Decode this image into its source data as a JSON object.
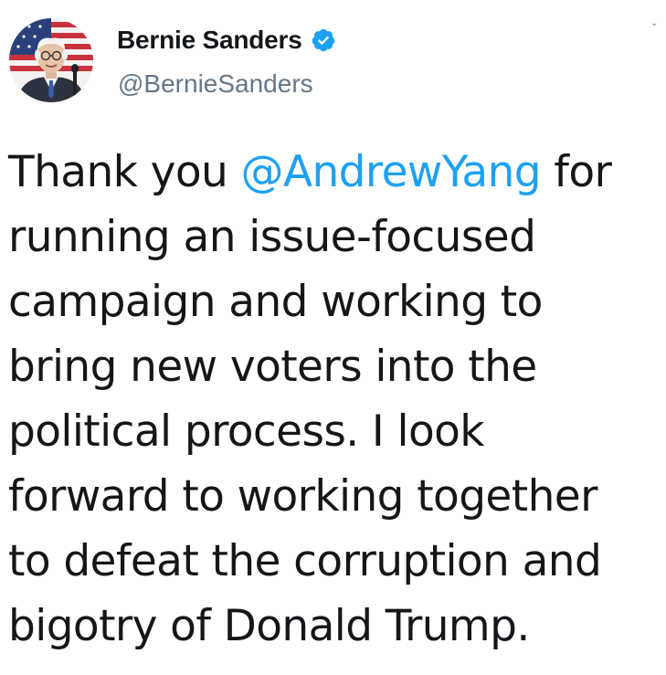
{
  "author": {
    "display_name": "Bernie Sanders",
    "handle": "@BernieSanders",
    "verified": true
  },
  "tweet": {
    "line1_before": "Thank you ",
    "mention": "@AndrewYang",
    "line1_after": " for",
    "lines": [
      "running an issue-focused",
      "campaign and working to",
      "bring new voters into the",
      "political process. I look",
      "forward to working together",
      "to defeat the corruption and",
      "bigotry of Donald Trump."
    ]
  },
  "icons": {
    "verified": "verified-badge-icon",
    "menu": "chevron-down-icon"
  },
  "colors": {
    "text": "#14171a",
    "secondary": "#657786",
    "accent": "#1da1f2"
  }
}
